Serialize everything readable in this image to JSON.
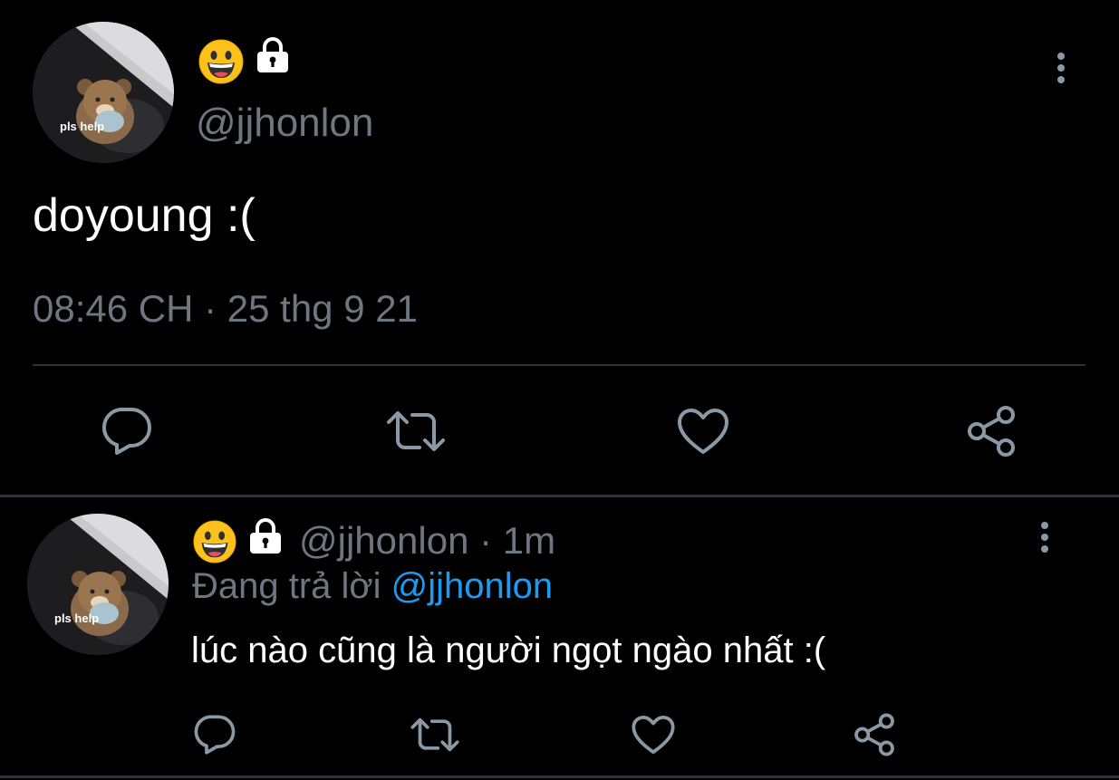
{
  "main_tweet": {
    "avatar_text": "pls help",
    "display_name_emoji": "grinning-face",
    "handle": "@jjhonlon",
    "text": "doyoung :(",
    "timestamp": "08:46 CH · 25 thg 9 21"
  },
  "reply_tweet": {
    "avatar_text": "pls help",
    "display_name_emoji": "grinning-face",
    "handle": "@jjhonlon",
    "time_ago": "· 1m",
    "replying_prefix": "Đang trả lời",
    "replying_to": "@jjhonlon",
    "text": "lúc nào cũng là người ngọt ngào nhất :("
  },
  "colors": {
    "background": "#000000",
    "muted": "#6e7781",
    "link": "#1d9bf0",
    "icon": "#8b98a5",
    "divider": "#2f3336"
  },
  "icons": [
    "comment-icon",
    "retweet-icon",
    "like-icon",
    "share-icon",
    "lock-icon",
    "more-vertical-icon"
  ]
}
